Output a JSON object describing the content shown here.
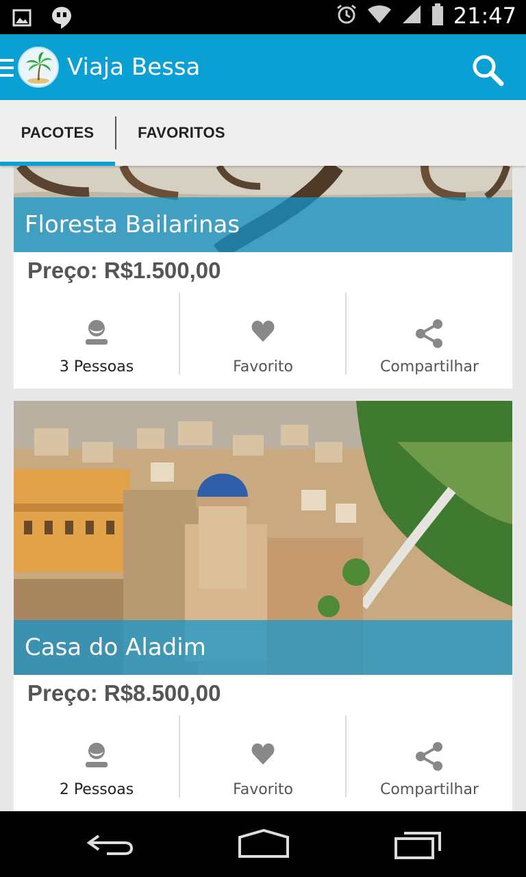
{
  "status_bar": {
    "time": "21:47",
    "icons": [
      "image-notification-icon",
      "hangouts-icon",
      "alarm-icon",
      "wifi-icon",
      "signal-icon",
      "battery-icon"
    ]
  },
  "app_bar": {
    "title": "Viaja Bessa",
    "icons": [
      "menu-icon",
      "palm-tree-logo",
      "search-icon"
    ],
    "color": "#0aa0d4"
  },
  "tabs": [
    {
      "label": "PACOTES",
      "selected": true
    },
    {
      "label": "FAVORITOS",
      "selected": false
    }
  ],
  "packages": [
    {
      "name": "Floresta Bailarinas",
      "price": "Preço: R$1.500,00",
      "people": "3 Pessoas",
      "favorite_label": "Favorito",
      "share_label": "Compartilhar"
    },
    {
      "name": "Casa do Aladim",
      "price": "Preço: R$8.500,00",
      "people": "2 Pessoas",
      "favorite_label": "Favorito",
      "share_label": "Compartilhar"
    }
  ],
  "nav_bar": {
    "icons": [
      "back-icon",
      "home-icon",
      "recent-apps-icon"
    ]
  }
}
